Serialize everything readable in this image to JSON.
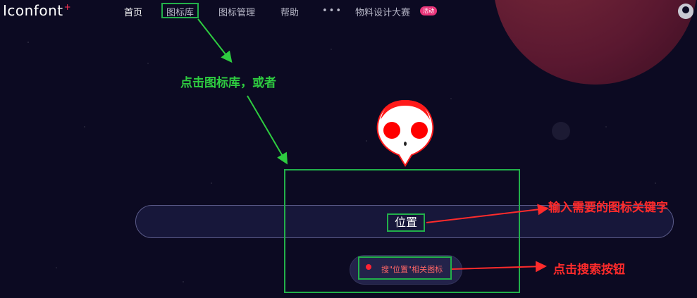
{
  "header": {
    "logo": "Iconfont",
    "logo_plus": "+",
    "nav": [
      {
        "label": "首页"
      },
      {
        "label": "图标库"
      },
      {
        "label": "图标管理"
      },
      {
        "label": "帮助"
      },
      {
        "label": "物料设计大赛"
      }
    ],
    "more": "•••",
    "badge": "活动"
  },
  "search": {
    "value": "位置",
    "button_label": "搜\"位置\"相关图标"
  },
  "annotations": {
    "click_library": "点击图标库，或者",
    "enter_keyword": "输入需要的图标关键字",
    "click_search": "点击搜索按钮"
  },
  "colors": {
    "background": "#0c0a22",
    "annotation_green": "#2ecc40",
    "annotation_red": "#ff2b2b",
    "badge": "#e8357a"
  },
  "icons": [
    "skull-mascot-icon",
    "user-avatar-icon",
    "search-location-icon"
  ]
}
